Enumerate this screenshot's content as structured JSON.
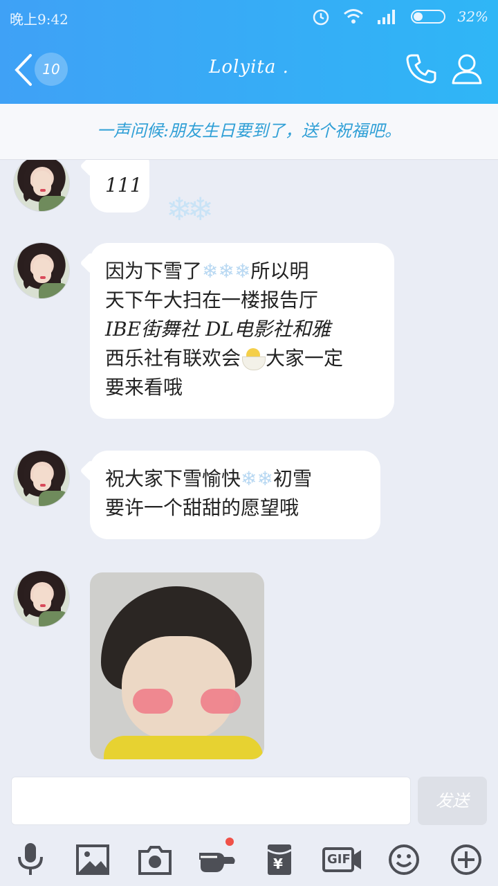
{
  "status": {
    "time": "晚上9:42",
    "battery": "32%",
    "battery_level": 0.32
  },
  "header": {
    "unread_count": "10",
    "contact_name": "Lolyita ."
  },
  "banner": {
    "text": "一声问候:朋友生日要到了，送个祝福吧。"
  },
  "messages": [
    {
      "text": "111"
    },
    {
      "line1_a": "因为下雪了",
      "snow": "❄❄❄",
      "line1_b": "所以明",
      "line2": "天下午大扫在一楼报告厅",
      "line3": "IBE街舞社  DL电影社和雅",
      "line4_a": "西乐社有联欢会",
      "line4_b": "大家一定",
      "line5": "要来看哦"
    },
    {
      "line1_a": "祝大家下雪愉快",
      "snow": "❄❄",
      "line1_b": "初雪",
      "line2": "要许一个甜甜的愿望哦"
    }
  ],
  "floating_sticker": "❄❄",
  "composer": {
    "input_value": "",
    "send_label": "发送"
  },
  "toolbar": {
    "items": [
      "microphone-icon",
      "image-icon",
      "camera-icon",
      "poke-icon",
      "red-packet-icon",
      "gif-icon",
      "emoji-icon",
      "plus-icon"
    ],
    "gif_label": "GIF",
    "yen_label": "¥"
  },
  "colors": {
    "header": "#3fa1f6",
    "banner_text": "#2f9fd6",
    "chat_bg": "#eaedf5"
  }
}
